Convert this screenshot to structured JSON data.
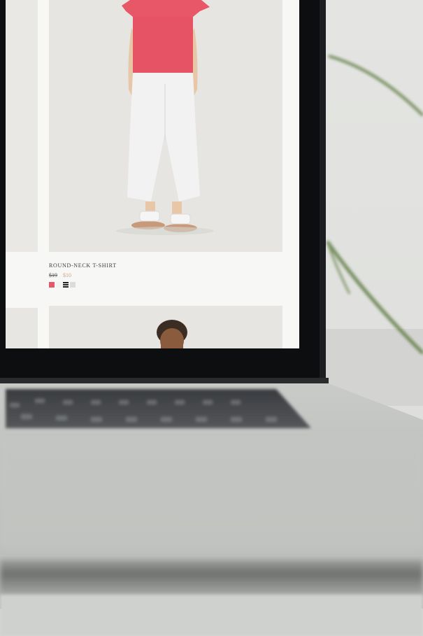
{
  "product": {
    "name": "ROUND-NECK T-SHIRT",
    "price_old": "$19",
    "price_new": "$10",
    "swatches": [
      {
        "name": "coral",
        "color": "#e85767"
      },
      {
        "name": "light",
        "color": "#f2f2f2"
      },
      {
        "name": "stripe",
        "color": "#222222"
      },
      {
        "name": "gray",
        "color": "#dcdcdc"
      }
    ]
  },
  "colors": {
    "laptop_bezel": "#0d0e10",
    "laptop_body": "#c9cbc8",
    "tshirt": "#e85767",
    "pants": "#f2f2f2",
    "background_wall": "#e2e3e0",
    "plant_leaf": "#5e7a43"
  }
}
